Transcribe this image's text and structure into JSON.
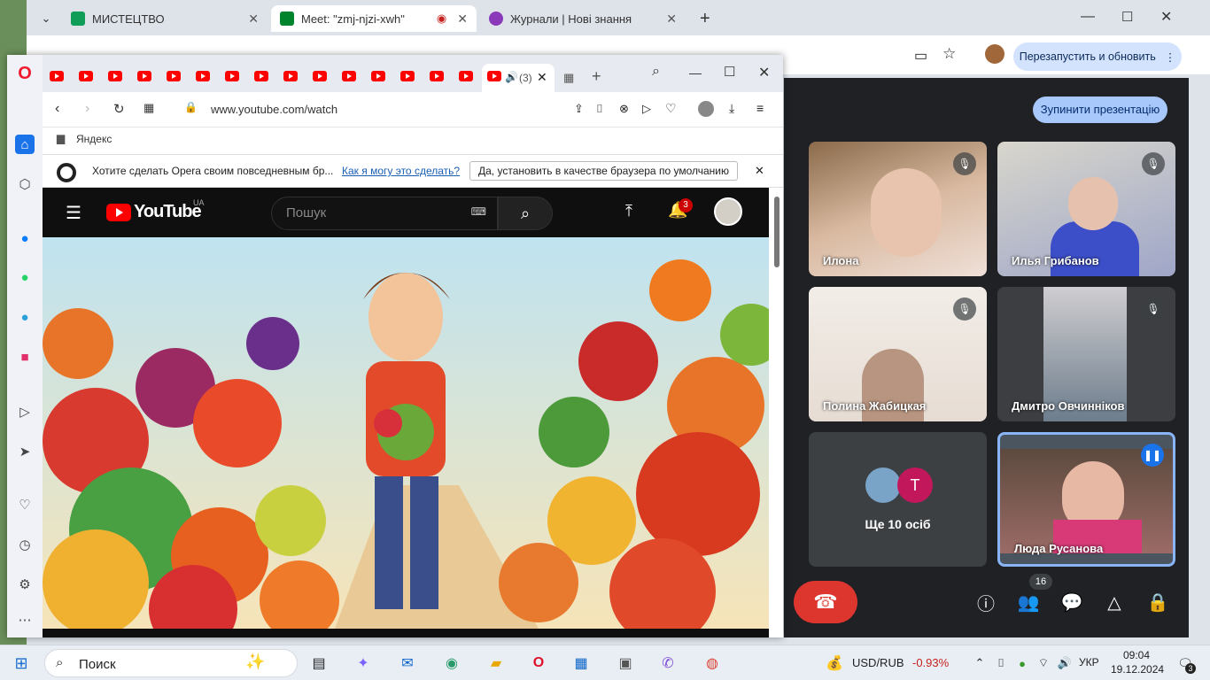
{
  "chrome": {
    "tabs": [
      {
        "label": "МИСТЕЦТВО"
      },
      {
        "label": "Meet: \"zmj-njzi-xwh\""
      },
      {
        "label": "Журнали | Нові знання"
      }
    ],
    "restart_label": "Перезапустить и обновить"
  },
  "meet": {
    "stop_presentation": "Зупинити презентацію",
    "participants": [
      {
        "name": "Илона"
      },
      {
        "name": "Илья Грибанов"
      },
      {
        "name": "Полина Жабицкая"
      },
      {
        "name": "Дмитро Овчинніков"
      },
      {
        "name": "Ще 10 осіб",
        "avatar_letter": "T"
      },
      {
        "name": "Люда Русанова"
      }
    ],
    "people_count": "16"
  },
  "opera": {
    "active_tab_label": "(3)",
    "url": "www.youtube.com/watch",
    "bookmark": "Яндекс",
    "infobar": {
      "text": "Хотите сделать Opera своим повседневным бр...",
      "link": "Как я могу это сделать?",
      "button": "Да, установить в качестве браузера по умолчанию"
    },
    "youtube": {
      "logo_text": "YouTube",
      "region": "UA",
      "search_placeholder": "Пошук",
      "notif_count": "3"
    }
  },
  "taskbar": {
    "search_label": "Поиск",
    "currency": "USD/RUB",
    "currency_change": "-0.93%",
    "lang": "УКР",
    "time": "09:04",
    "date": "19.12.2024",
    "notif_count": "3"
  }
}
